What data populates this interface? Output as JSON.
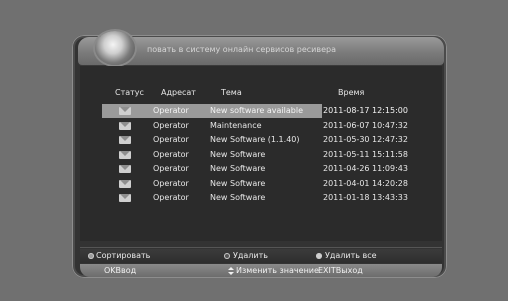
{
  "title_text": "повать в систему онлайн сервисов ресивера",
  "columns": {
    "status": "Статус",
    "sender": "Адресат",
    "subject": "Тема",
    "time": "Время"
  },
  "messages": [
    {
      "sender": "Operator",
      "subject": "New software available",
      "time": "2011-08-17 12:15:00",
      "selected": true
    },
    {
      "sender": "Operator",
      "subject": "Maintenance",
      "time": "2011-06-07 10:47:32"
    },
    {
      "sender": "Operator",
      "subject": "New Software (1.1.40)",
      "time": "2011-05-30 12:47:32"
    },
    {
      "sender": "Operator",
      "subject": "New Software",
      "time": "2011-05-11 15:11:58"
    },
    {
      "sender": "Operator",
      "subject": "New Software",
      "time": "2011-04-26 11:09:43"
    },
    {
      "sender": "Operator",
      "subject": "New Software",
      "time": "2011-04-01 14:20:28"
    },
    {
      "sender": "Operator",
      "subject": "New Software",
      "time": "2011-01-18 13:43:33"
    }
  ],
  "footer": {
    "sort": "Сортировать",
    "delete": "Удалить",
    "delete_all": "Удалить все",
    "ok_key": "OK",
    "ok_label": "Ввод",
    "change_label": "Изменить значение",
    "exit_key": "EXIT",
    "exit_label": "Выход"
  },
  "icons": {
    "status_icon": "envelope-icon",
    "logo": "globe-logo",
    "sort_dot": "dot-icon",
    "change_arrows": "up-down-arrow-icon"
  }
}
